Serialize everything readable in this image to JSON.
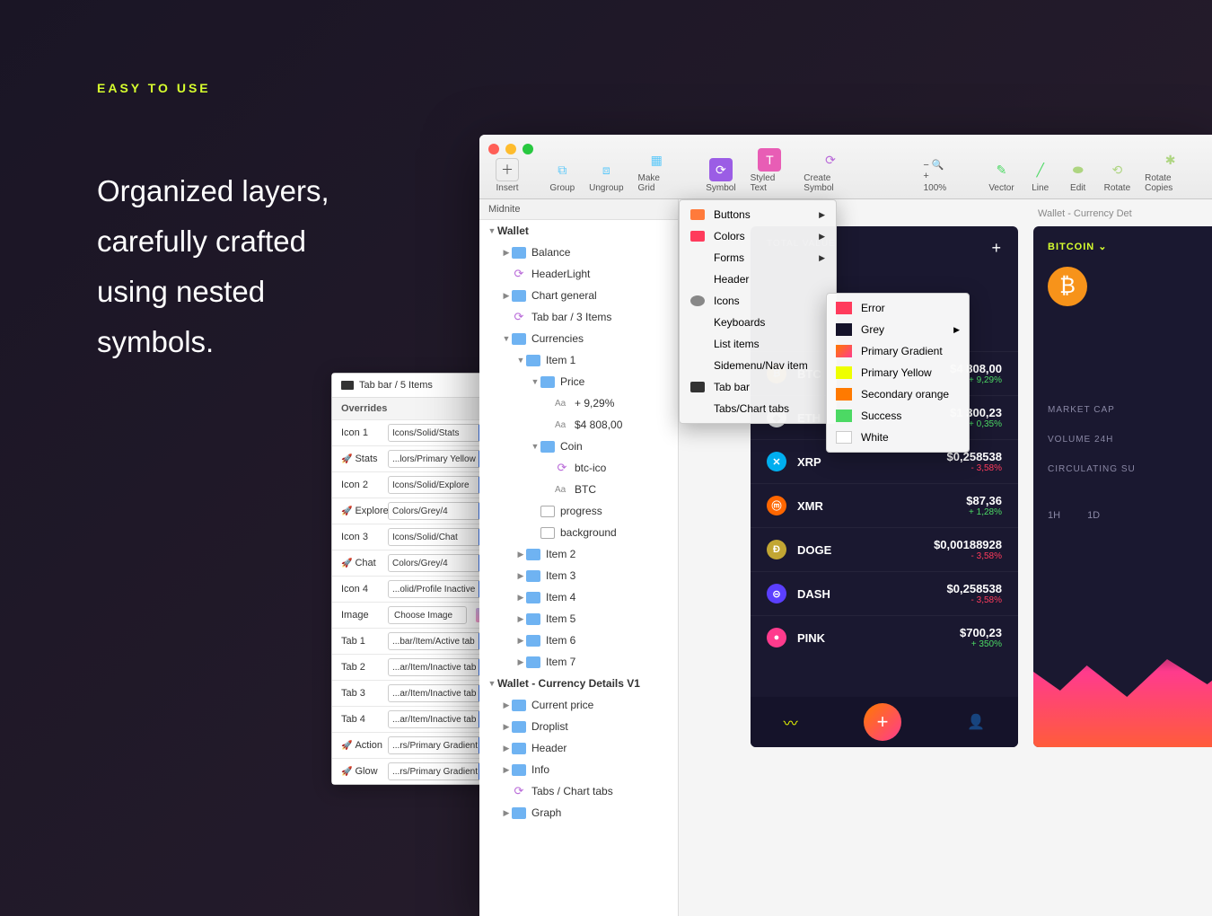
{
  "hero": {
    "tag": "EASY TO USE",
    "heading_l1": "Organized layers,",
    "heading_l2": "carefully crafted",
    "heading_l3": "using nested",
    "heading_l4": "symbols."
  },
  "overrides": {
    "title": "Tab bar / 5 Items",
    "section": "Overrides",
    "rows": [
      {
        "label": "Icon 1",
        "value": "Icons/Solid/Stats",
        "rocket": false
      },
      {
        "label": "Stats",
        "value": "...lors/Primary Yellow",
        "rocket": true
      },
      {
        "label": "Icon 2",
        "value": "Icons/Solid/Explore",
        "rocket": false
      },
      {
        "label": "Explore",
        "value": "Colors/Grey/4",
        "rocket": true
      },
      {
        "label": "Icon 3",
        "value": "Icons/Solid/Chat",
        "rocket": false
      },
      {
        "label": "Chat",
        "value": "Colors/Grey/4",
        "rocket": true
      },
      {
        "label": "Icon 4",
        "value": "...olid/Profile Inactive",
        "rocket": false
      }
    ],
    "image_label": "Image",
    "image_btn": "Choose Image",
    "tabs": [
      {
        "label": "Tab 1",
        "value": "...bar/Item/Active tab"
      },
      {
        "label": "Tab 2",
        "value": "...ar/Item/Inactive tab"
      },
      {
        "label": "Tab 3",
        "value": "...ar/Item/Inactive tab"
      },
      {
        "label": "Tab 4",
        "value": "...ar/Item/Inactive tab"
      },
      {
        "label": "Action",
        "value": "...rs/Primary Gradient",
        "rocket": true
      },
      {
        "label": "Glow",
        "value": "...rs/Primary Gradient",
        "rocket": true
      }
    ]
  },
  "toolbar": {
    "items": [
      "Insert",
      "Group",
      "Ungroup",
      "Make Grid",
      "Symbol",
      "Styled Text",
      "Create Symbol",
      "100%",
      "Vector",
      "Line",
      "Edit",
      "Rotate",
      "Rotate Copies"
    ]
  },
  "layers": {
    "document": "Midnite",
    "nodes": [
      {
        "depth": 1,
        "type": "artboard",
        "name": "Wallet",
        "open": true
      },
      {
        "depth": 2,
        "type": "folder",
        "name": "Balance",
        "open": false,
        "arrow": true
      },
      {
        "depth": 2,
        "type": "sym",
        "name": "HeaderLight"
      },
      {
        "depth": 2,
        "type": "folder",
        "name": "Chart general",
        "open": false,
        "arrow": true
      },
      {
        "depth": 2,
        "type": "sym",
        "name": "Tab bar / 3 Items"
      },
      {
        "depth": 2,
        "type": "folder",
        "name": "Currencies",
        "open": true,
        "arrow": true
      },
      {
        "depth": 3,
        "type": "folder",
        "name": "Item 1",
        "open": true,
        "arrow": true
      },
      {
        "depth": 4,
        "type": "folder",
        "name": "Price",
        "open": true,
        "arrow": true
      },
      {
        "depth": 5,
        "type": "txt",
        "name": "+ 9,29%"
      },
      {
        "depth": 5,
        "type": "txt",
        "name": "$4 808,00"
      },
      {
        "depth": 4,
        "type": "folder",
        "name": "Coin",
        "open": true,
        "arrow": true
      },
      {
        "depth": 5,
        "type": "sym",
        "name": "btc-ico"
      },
      {
        "depth": 5,
        "type": "txt",
        "name": "BTC"
      },
      {
        "depth": 4,
        "type": "rect",
        "name": "progress"
      },
      {
        "depth": 4,
        "type": "rect",
        "name": "background"
      },
      {
        "depth": 3,
        "type": "folder",
        "name": "Item 2",
        "arrow": true
      },
      {
        "depth": 3,
        "type": "folder",
        "name": "Item 3",
        "arrow": true
      },
      {
        "depth": 3,
        "type": "folder",
        "name": "Item 4",
        "arrow": true
      },
      {
        "depth": 3,
        "type": "folder",
        "name": "Item 5",
        "arrow": true
      },
      {
        "depth": 3,
        "type": "folder",
        "name": "Item 6",
        "arrow": true
      },
      {
        "depth": 3,
        "type": "folder",
        "name": "Item 7",
        "arrow": true
      },
      {
        "depth": 1,
        "type": "artboard",
        "name": "Wallet - Currency Details V1",
        "open": true
      },
      {
        "depth": 2,
        "type": "folder",
        "name": "Current price",
        "arrow": true
      },
      {
        "depth": 2,
        "type": "folder",
        "name": "Droplist",
        "arrow": true
      },
      {
        "depth": 2,
        "type": "folder",
        "name": "Header",
        "arrow": true
      },
      {
        "depth": 2,
        "type": "folder",
        "name": "Info",
        "arrow": true
      },
      {
        "depth": 2,
        "type": "sym",
        "name": "Tabs / Chart tabs"
      },
      {
        "depth": 2,
        "type": "folder",
        "name": "Graph",
        "arrow": true
      }
    ]
  },
  "menu1": [
    {
      "label": "Buttons",
      "color": "#ff7a3b",
      "arrow": true
    },
    {
      "label": "Colors",
      "color": "#ff3b5c",
      "arrow": true
    },
    {
      "label": "Forms",
      "color": "",
      "arrow": true
    },
    {
      "label": "Header",
      "color": ""
    },
    {
      "label": "Icons",
      "color": "#888",
      "round": true
    },
    {
      "label": "Keyboards",
      "color": ""
    },
    {
      "label": "List items",
      "color": ""
    },
    {
      "label": "Sidemenu/Nav item",
      "color": ""
    },
    {
      "label": "Tab bar",
      "color": "#333"
    },
    {
      "label": "Tabs/Chart tabs",
      "color": ""
    }
  ],
  "menu2": [
    {
      "label": "Error",
      "color": "#ff3b5c"
    },
    {
      "label": "Grey",
      "color": "#15132a",
      "arrow": true
    },
    {
      "label": "Primary Gradient",
      "color": "linear-gradient(135deg,#ff7a00,#ff3b8d)"
    },
    {
      "label": "Primary Yellow",
      "color": "#eeff00"
    },
    {
      "label": "Secondary orange",
      "color": "#ff7a00"
    },
    {
      "label": "Success",
      "color": "#4cd964"
    },
    {
      "label": "White",
      "color": "#ffffff",
      "border": true
    }
  ],
  "wallet": {
    "total_label": "TOTAL VALUE",
    "artboard_label2": "Wallet - Currency Det",
    "coins": [
      {
        "sym": "BTC",
        "ico": "₿",
        "icoBg": "#f7931a",
        "price": "$4 808,00",
        "change": "+ 9,29%",
        "pos": true,
        "hidden": true
      },
      {
        "sym": "ETH",
        "ico": "◆",
        "icoBg": "#eceff1",
        "icoFg": "#555",
        "price": "$1 300,23",
        "change": "+ 0,35%",
        "pos": true,
        "hidden": true
      },
      {
        "sym": "BTC",
        "ico": "₿",
        "icoBg": "#f7931a",
        "price": "$4 808,00",
        "change": "+ 9,29%",
        "pos": true
      },
      {
        "sym": "ETH",
        "ico": "◆",
        "icoBg": "#eceff1",
        "icoFg": "#555",
        "price": "$1 300,23",
        "change": "+ 0,35%",
        "pos": true
      },
      {
        "sym": "XRP",
        "ico": "✕",
        "icoBg": "#00aeef",
        "price": "$0,258538",
        "change": "- 3,58%",
        "pos": false
      },
      {
        "sym": "XMR",
        "ico": "ⓜ",
        "icoBg": "#ff6600",
        "price": "$87,36",
        "change": "+ 1,28%",
        "pos": true
      },
      {
        "sym": "DOGE",
        "ico": "Ð",
        "icoBg": "#c2a633",
        "price": "$0,00188928",
        "change": "- 3,58%",
        "pos": false
      },
      {
        "sym": "DASH",
        "ico": "⊝",
        "icoBg": "#5b3fff",
        "price": "$0,258538",
        "change": "- 3,58%",
        "pos": false
      },
      {
        "sym": "PINK",
        "ico": "●",
        "icoBg": "#ff3b8d",
        "price": "$700,23",
        "change": "+ 350%",
        "pos": true
      }
    ]
  },
  "detail": {
    "tag": "BITCOIN ⌄",
    "stats": [
      "MARKET CAP",
      "VOLUME 24H",
      "CIRCULATING SU"
    ],
    "tabs": [
      "1H",
      "1D"
    ]
  }
}
